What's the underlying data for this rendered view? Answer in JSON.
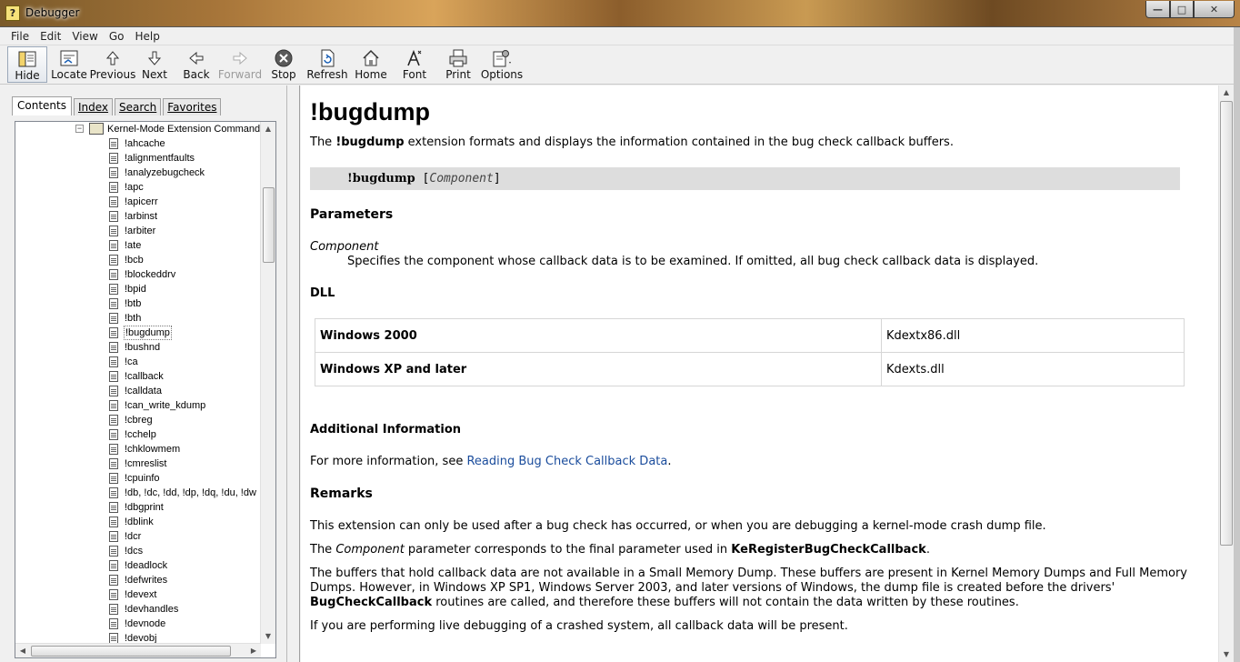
{
  "window": {
    "title": "Debugger",
    "min_glyph": "—",
    "max_glyph": "□",
    "close_glyph": "✕"
  },
  "menu": [
    "File",
    "Edit",
    "View",
    "Go",
    "Help"
  ],
  "toolbar": {
    "hide": "Hide",
    "locate": "Locate",
    "previous": "Previous",
    "next": "Next",
    "back": "Back",
    "forward": "Forward",
    "stop": "Stop",
    "refresh": "Refresh",
    "home": "Home",
    "font": "Font",
    "print": "Print",
    "options": "Options"
  },
  "tabs": {
    "contents": "Contents",
    "index": "Index",
    "search": "Search",
    "favorites": "Favorites"
  },
  "tree": {
    "root": "Kernel-Mode Extension Commands",
    "toggle": "−",
    "items": [
      "!ahcache",
      "!alignmentfaults",
      "!analyzebugcheck",
      "!apc",
      "!apicerr",
      "!arbinst",
      "!arbiter",
      "!ate",
      "!bcb",
      "!blockeddrv",
      "!bpid",
      "!btb",
      "!bth",
      "!bugdump",
      "!bushnd",
      "!ca",
      "!callback",
      "!calldata",
      "!can_write_kdump",
      "!cbreg",
      "!cchelp",
      "!chklowmem",
      "!cmreslist",
      "!cpuinfo",
      "!db, !dc, !dd, !dp, !dq, !du, !dw",
      "!dbgprint",
      "!dblink",
      "!dcr",
      "!dcs",
      "!deadlock",
      "!defwrites",
      "!devext",
      "!devhandles",
      "!devnode",
      "!devobj"
    ],
    "selected": "!bugdump"
  },
  "content": {
    "title": "!bugdump",
    "intro_pre": "The ",
    "intro_cmd": "!bugdump",
    "intro_post": " extension formats and displays the information contained in the bug check callback buffers.",
    "syntax_cmd": "!bugdump",
    "syntax_open": " [",
    "syntax_param": "Component",
    "syntax_close": "]",
    "parameters_heading": "Parameters",
    "param_name": "Component",
    "param_desc": "Specifies the component whose callback data is to be examined. If omitted, all bug check callback data is displayed.",
    "dll_heading": "DLL",
    "dll_rows": [
      {
        "os": "Windows 2000",
        "dll": "Kdextx86.dll"
      },
      {
        "os": "Windows XP and later",
        "dll": "Kdexts.dll"
      }
    ],
    "additional_heading": "Additional Information",
    "additional_pre": "For more information, see ",
    "additional_link": "Reading Bug Check Callback Data",
    "additional_post": ".",
    "remarks_heading": "Remarks",
    "remark1": "This extension can only be used after a bug check has occurred, or when you are debugging a kernel-mode crash dump file.",
    "remark2_pre": "The ",
    "remark2_em": "Component",
    "remark2_mid": " parameter corresponds to the final parameter used in ",
    "remark2_bold": "KeRegisterBugCheckCallback",
    "remark2_post": ".",
    "remark3_line1": "The buffers that hold callback data are not available in a Small Memory Dump. These buffers are present in Kernel Memory Dumps and Full Memory",
    "remark3_line2": "Dumps. However, in Windows XP SP1, Windows Server 2003, and later versions of Windows, the dump file is created before the drivers'",
    "remark3_bold": "BugCheckCallback",
    "remark3_line3_post": " routines are called, and therefore these buffers will not contain the data written by these routines.",
    "remark4": "If you are performing live debugging of a crashed system, all callback data will be present."
  },
  "colors": {
    "link": "#1a4c9c",
    "syntax_bg": "#dddddd"
  }
}
